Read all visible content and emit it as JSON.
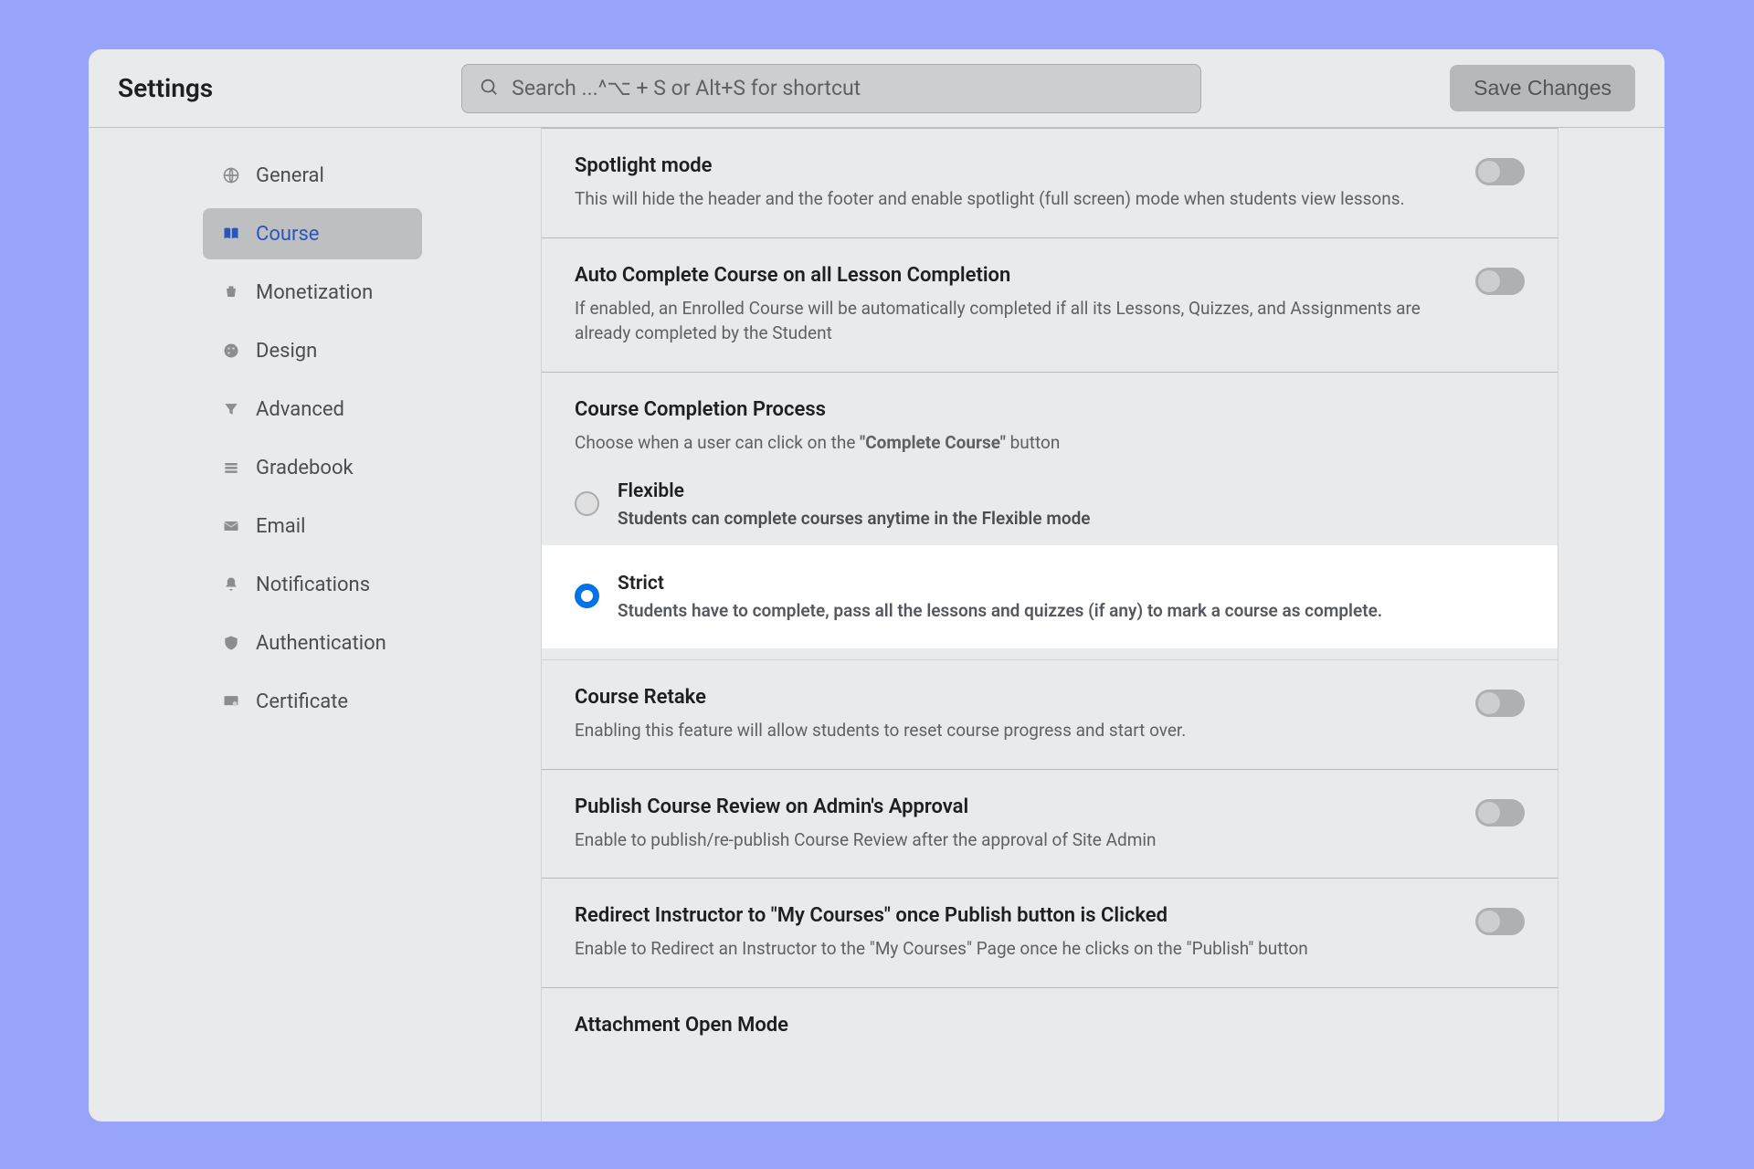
{
  "header": {
    "title": "Settings",
    "search_placeholder": "Search ...^⌥ + S or Alt+S for shortcut",
    "save_label": "Save Changes"
  },
  "sidebar": {
    "items": [
      {
        "label": "General",
        "icon": "globe-icon"
      },
      {
        "label": "Course",
        "icon": "book-icon"
      },
      {
        "label": "Monetization",
        "icon": "shopping-icon"
      },
      {
        "label": "Design",
        "icon": "palette-icon"
      },
      {
        "label": "Advanced",
        "icon": "filter-icon"
      },
      {
        "label": "Gradebook",
        "icon": "layers-icon"
      },
      {
        "label": "Email",
        "icon": "mail-icon"
      },
      {
        "label": "Notifications",
        "icon": "bell-icon"
      },
      {
        "label": "Authentication",
        "icon": "shield-icon"
      },
      {
        "label": "Certificate",
        "icon": "certificate-icon"
      }
    ],
    "active_index": 1
  },
  "settings": {
    "spotlight": {
      "title": "Spotlight mode",
      "desc": "This will hide the header and the footer and enable spotlight (full screen) mode when students view lessons.",
      "enabled": false
    },
    "auto_complete": {
      "title": "Auto Complete Course on all Lesson Completion",
      "desc": "If enabled, an Enrolled Course will be automatically completed if all its Lessons, Quizzes, and Assignments are already completed by the Student",
      "enabled": false
    },
    "completion_process": {
      "title": "Course Completion Process",
      "desc_prefix": "Choose when a user can click on the ",
      "desc_strong": "\"Complete Course\"",
      "desc_suffix": " button",
      "options": [
        {
          "label": "Flexible",
          "desc": "Students can complete courses anytime in the Flexible mode"
        },
        {
          "label": "Strict",
          "desc": "Students have to complete, pass all the lessons and quizzes (if any) to mark a course as complete."
        }
      ],
      "selected": 1
    },
    "retake": {
      "title": "Course Retake",
      "desc": "Enabling this feature will allow students to reset course progress and start over.",
      "enabled": false
    },
    "publish_review": {
      "title": "Publish Course Review on Admin's Approval",
      "desc": "Enable to publish/re-publish Course Review after the approval of Site Admin",
      "enabled": false
    },
    "redirect_instructor": {
      "title": "Redirect Instructor to \"My Courses\" once Publish button is Clicked",
      "desc": "Enable to Redirect an Instructor to the \"My Courses\" Page once he clicks on the \"Publish\" button",
      "enabled": false
    },
    "attachment_open": {
      "title": "Attachment Open Mode"
    }
  }
}
